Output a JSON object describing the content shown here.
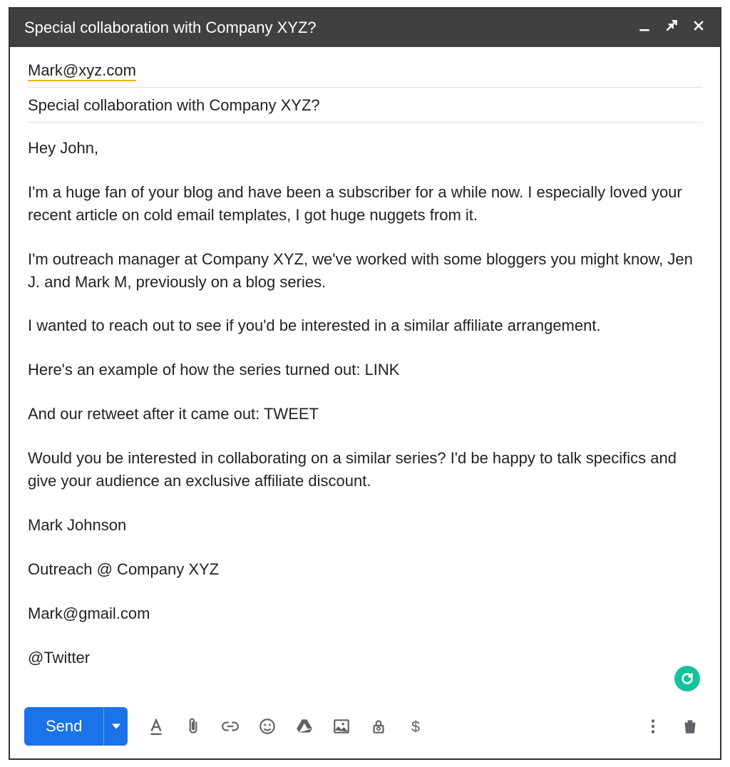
{
  "header": {
    "title": "Special collaboration with Company XYZ?"
  },
  "fields": {
    "to": "Mark@xyz.com",
    "subject": "Special collaboration with Company XYZ?"
  },
  "body": {
    "greeting": "Hey John,",
    "p1": "I'm a huge fan of your blog and have been a subscriber for a while now. I especially loved your recent article on cold email templates, I got huge nuggets from it.",
    "p2": "I'm outreach manager at Company XYZ, we've worked with some bloggers you might know, Jen J. and Mark M, previously on a blog series.",
    "p3": "I wanted to reach out to see if you'd be interested in a similar affiliate arrangement.",
    "p4": "Here's an example of how the series turned out: LINK",
    "p5": "And our retweet after it came out: TWEET",
    "p6": "Would you be interested in collaborating on a similar series? I'd be happy to talk specifics and give your audience an exclusive affiliate discount.",
    "sig1": "Mark Johnson",
    "sig2": "Outreach @ Company XYZ",
    "sig3": "Mark@gmail.com",
    "sig4": "@Twitter"
  },
  "toolbar": {
    "send_label": "Send"
  }
}
